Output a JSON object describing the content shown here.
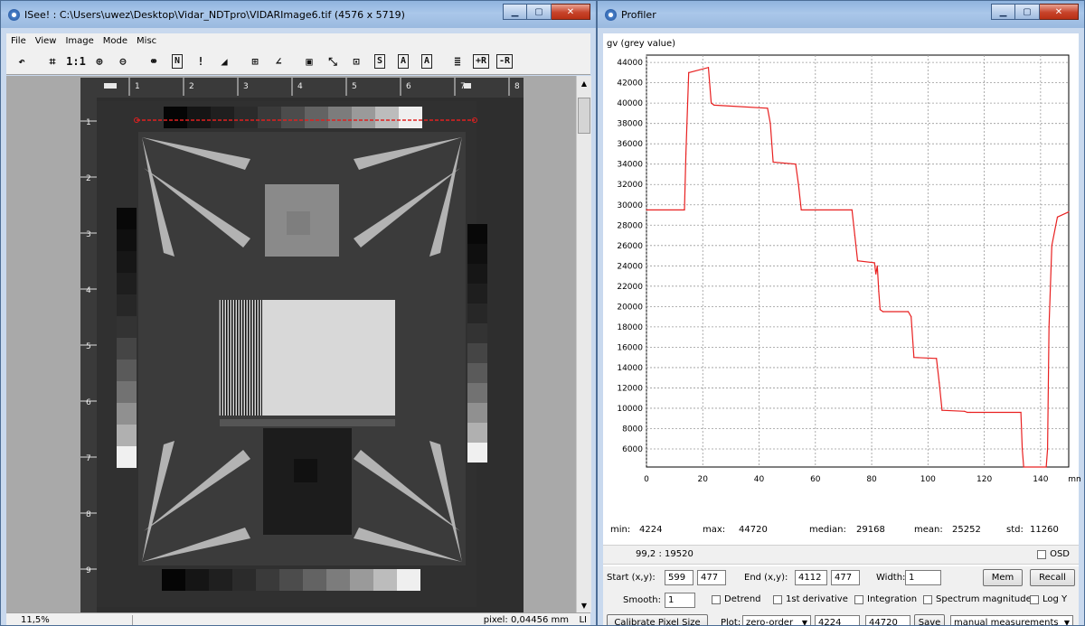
{
  "left_window": {
    "title": "ISee! : C:\\Users\\uwez\\Desktop\\Vidar_NDTpro\\VIDARImage6.tif (4576 x 5719)",
    "menu": [
      "File",
      "View",
      "Image",
      "Mode",
      "Misc"
    ],
    "toolbar_buttons": [
      {
        "name": "undo-icon",
        "glyph": "↶"
      },
      {
        "name": "fit-window-icon",
        "glyph": "⌗"
      },
      {
        "name": "one-to-one-icon",
        "glyph": "1:1"
      },
      {
        "name": "zoom-in-icon",
        "glyph": "⊕"
      },
      {
        "name": "zoom-out-icon",
        "glyph": "⊖"
      },
      {
        "name": "link-icon",
        "glyph": "⚭"
      },
      {
        "name": "normalize-icon",
        "glyph": "N"
      },
      {
        "name": "alert-icon",
        "glyph": "!"
      },
      {
        "name": "histogram-icon",
        "glyph": "◢"
      },
      {
        "name": "grid-icon",
        "glyph": "⊞"
      },
      {
        "name": "angle-icon",
        "glyph": "∠"
      },
      {
        "name": "image-icon",
        "glyph": "▣"
      },
      {
        "name": "profile-icon",
        "glyph": "⤡"
      },
      {
        "name": "roi-icon",
        "glyph": "⊡"
      },
      {
        "name": "snr-icon",
        "glyph": "S"
      },
      {
        "name": "annotation-a-icon",
        "glyph": "A"
      },
      {
        "name": "annotation-a2-icon",
        "glyph": "A"
      },
      {
        "name": "list-icon",
        "glyph": "≣"
      },
      {
        "name": "add-r-icon",
        "glyph": "+R"
      },
      {
        "name": "remove-r-icon",
        "glyph": "-R"
      }
    ],
    "ruler_top": [
      "1",
      "2",
      "3",
      "4",
      "5",
      "6",
      "7",
      "8"
    ],
    "ruler_left": [
      "1",
      "2",
      "3",
      "4",
      "5",
      "6",
      "7",
      "8",
      "9"
    ],
    "status": {
      "zoom": "11,5%",
      "pixel": "pixel: 0,04456 mm",
      "unit": "LI"
    }
  },
  "right_window": {
    "title": "Profiler",
    "y_axis_label": "gv (grey value)",
    "stats": {
      "min_label": "min:",
      "min": "4224",
      "max_label": "max:",
      "max": "44720",
      "median_label": "median:",
      "median": "29168",
      "mean_label": "mean:",
      "mean": "25252",
      "std_label": "std:",
      "std": "11260"
    },
    "cursor": "99,2 : 19520",
    "osd_label": "OSD",
    "start_label": "Start (x,y):",
    "start_x": "599",
    "start_y": "477",
    "end_label": "End (x,y):",
    "end_x": "4112",
    "end_y": "477",
    "width_label": "Width:",
    "width": "1",
    "mem_label": "Mem",
    "recall_label": "Recall",
    "smooth_label": "Smooth:",
    "smooth": "1",
    "options": [
      "Detrend",
      "1st derivative",
      "Integration",
      "Spectrum magnitude",
      "Log Y"
    ],
    "calibrate_label": "Calibrate Pixel Size",
    "plot_label": "Plot:",
    "plot_mode": "zero-order",
    "plot_min": "4224",
    "plot_max": "44720",
    "save_label": "Save",
    "measure_mode": "manual measurements"
  },
  "chart_data": {
    "type": "line",
    "title": "",
    "xlabel": "mm",
    "ylabel": "gv (grey value)",
    "xlim": [
      0,
      150
    ],
    "ylim": [
      4224,
      44720
    ],
    "x_ticks": [
      0,
      20,
      40,
      60,
      80,
      100,
      120,
      140
    ],
    "y_ticks": [
      6000,
      8000,
      10000,
      12000,
      14000,
      16000,
      18000,
      20000,
      22000,
      24000,
      26000,
      28000,
      30000,
      32000,
      34000,
      36000,
      38000,
      40000,
      42000,
      44000
    ],
    "x_tick_labels": [
      "0",
      "20",
      "40",
      "60",
      "80",
      "100",
      "120",
      "140"
    ],
    "y_tick_labels": [
      "6000",
      "8000",
      "10000",
      "12000",
      "14000",
      "16000",
      "18000",
      "20000",
      "22000",
      "24000",
      "26000",
      "28000",
      "30000",
      "32000",
      "34000",
      "36000",
      "38000",
      "40000",
      "42000",
      "44000"
    ],
    "grid": true,
    "color": "#e82020",
    "series": [
      {
        "x": [
          0,
          13.5,
          14,
          15,
          22,
          23,
          24,
          43,
          44,
          45,
          53,
          54,
          55,
          73,
          74,
          75,
          81,
          81.5,
          82,
          82.5,
          83,
          84,
          93,
          94,
          95,
          103,
          104,
          105,
          113,
          114,
          115,
          133,
          133.5,
          134,
          142,
          142.5,
          143,
          144,
          146,
          150
        ],
        "y": [
          29500,
          29500,
          35000,
          43000,
          43500,
          40000,
          39800,
          39500,
          38000,
          34200,
          34000,
          32000,
          29500,
          29500,
          27000,
          24500,
          24300,
          23200,
          24000,
          21500,
          19700,
          19500,
          19500,
          19000,
          15000,
          14900,
          12500,
          9800,
          9700,
          9600,
          9600,
          9600,
          6000,
          4224,
          4224,
          6000,
          18000,
          26000,
          28800,
          29300
        ]
      }
    ]
  }
}
